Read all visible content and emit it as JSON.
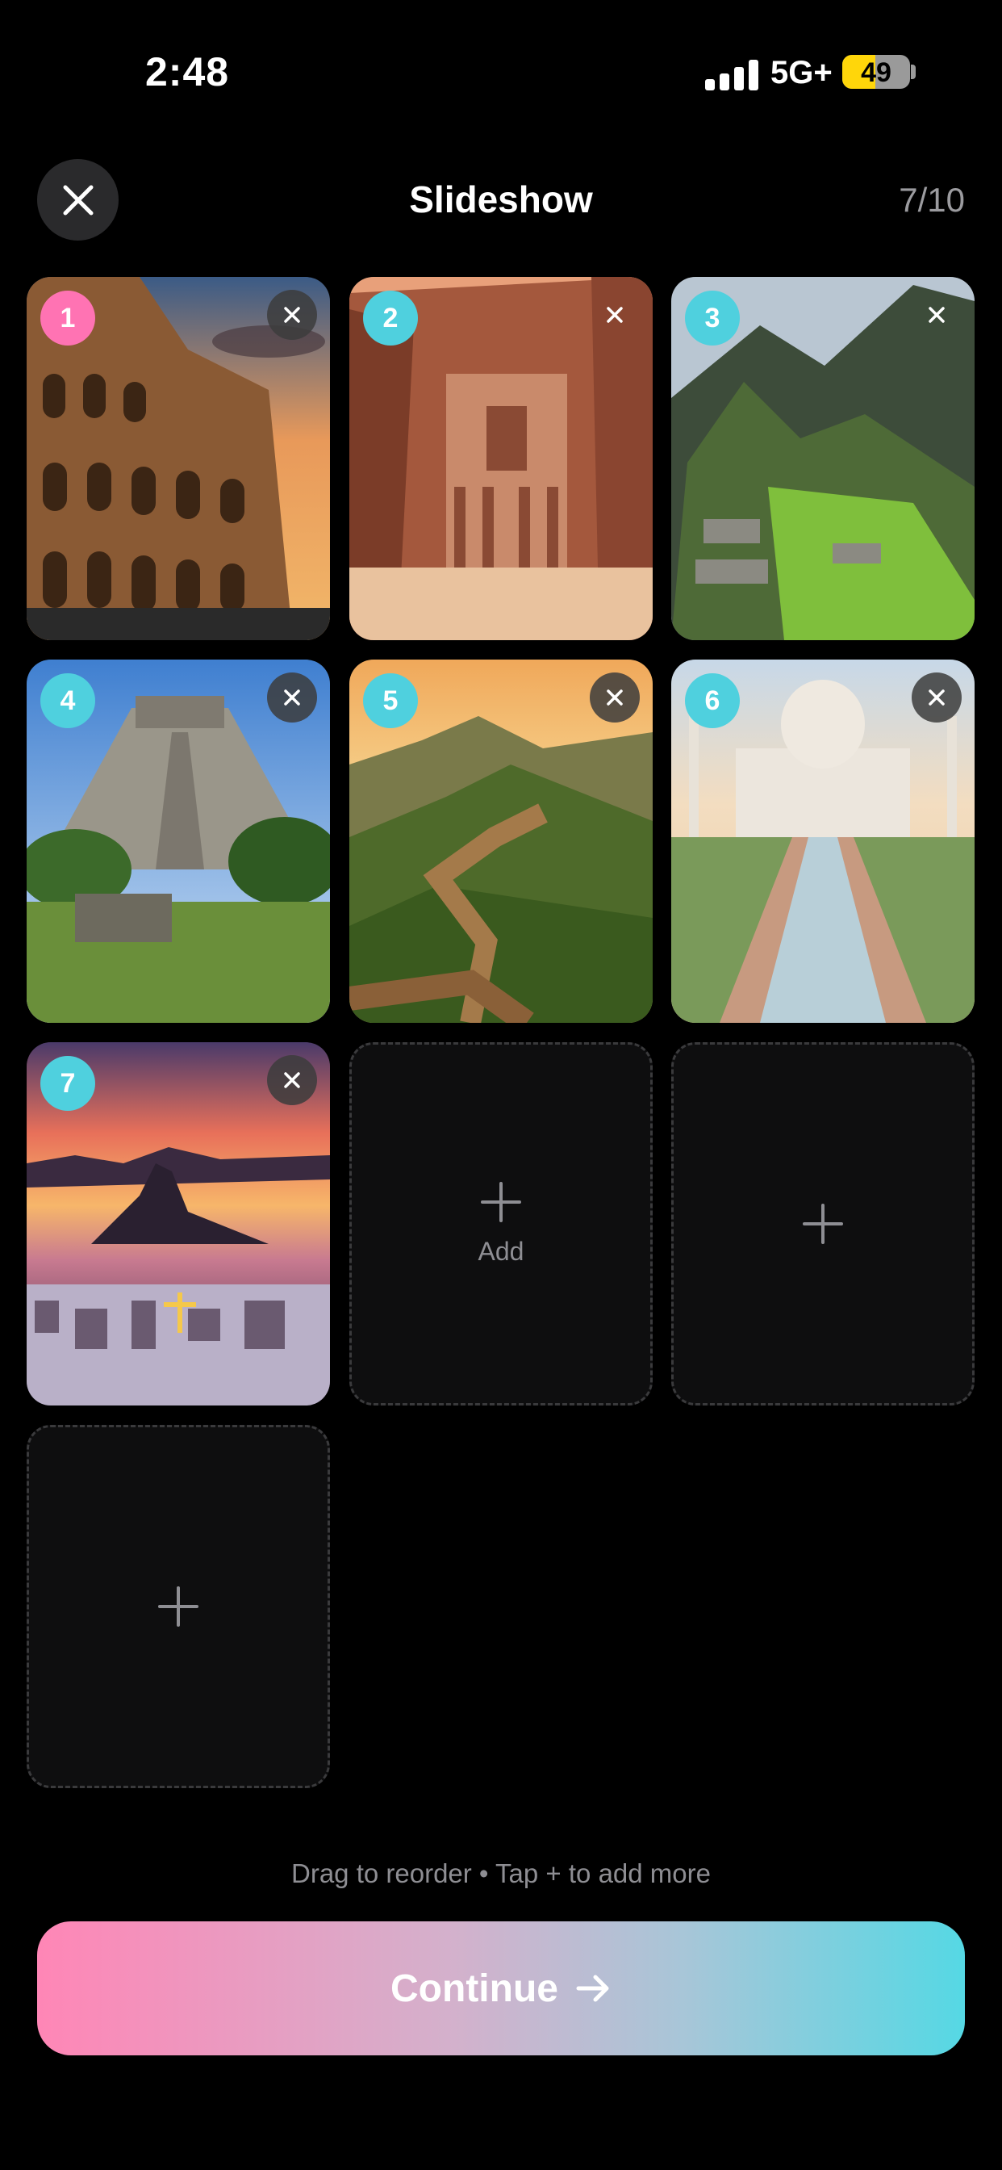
{
  "status_bar": {
    "time": "2:48",
    "network": "5G+",
    "battery": "49"
  },
  "header": {
    "title": "Slideshow",
    "counter": "7/10",
    "close_icon": "close-icon"
  },
  "slides": [
    {
      "number": "1",
      "scene": "Colosseum at sunset",
      "badge_color": "#ff73b3"
    },
    {
      "number": "2",
      "scene": "Petra Treasury",
      "badge_color": "#4fd0de"
    },
    {
      "number": "3",
      "scene": "Machu Picchu",
      "badge_color": "#4fd0de"
    },
    {
      "number": "4",
      "scene": "Chichen Itza pyramid",
      "badge_color": "#4fd0de"
    },
    {
      "number": "5",
      "scene": "Great Wall of China at sunset",
      "badge_color": "#4fd0de"
    },
    {
      "number": "6",
      "scene": "Taj Mahal",
      "badge_color": "#4fd0de"
    },
    {
      "number": "7",
      "scene": "Rio de Janeiro at sunset",
      "badge_color": "#4fd0de"
    }
  ],
  "empty_slots": {
    "add_label": "Add"
  },
  "hint": "Drag to reorder • Tap + to add more",
  "continue_button": {
    "label": "Continue",
    "icon": "arrow-right-icon"
  },
  "colors": {
    "accent_pink": "#ff86b6",
    "accent_cyan": "#55d8e4",
    "background": "#000000"
  }
}
